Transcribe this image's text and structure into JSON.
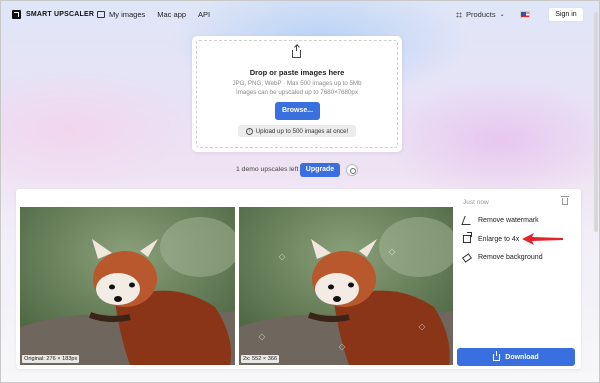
{
  "header": {
    "logo_text": "SMART UPSCALER",
    "nav": [
      "My images",
      "Mac app",
      "API"
    ],
    "products_label": "Products",
    "signin_label": "Sign in"
  },
  "upload": {
    "title": "Drop or paste images here",
    "line1": "JPG, PNG, WebP · Max 500 images up to 5Mb",
    "line2": "Images can be upscaled up to 7680×7680px",
    "browse_label": "Browse...",
    "tip": "Upload up to 500 images at once!"
  },
  "demo": {
    "text": "1 demo upscales left",
    "upgrade_label": "Upgrade"
  },
  "result": {
    "original_caption": "Original: 276 × 183px",
    "upscaled_caption": "2x: 552 × 366",
    "timestamp": "Just now",
    "options": [
      "Remove watermark",
      "Enlarge to 4x",
      "Remove background"
    ],
    "download_label": "Download"
  },
  "colors": {
    "accent": "#3a6fe0",
    "arrow": "#e0242a"
  }
}
